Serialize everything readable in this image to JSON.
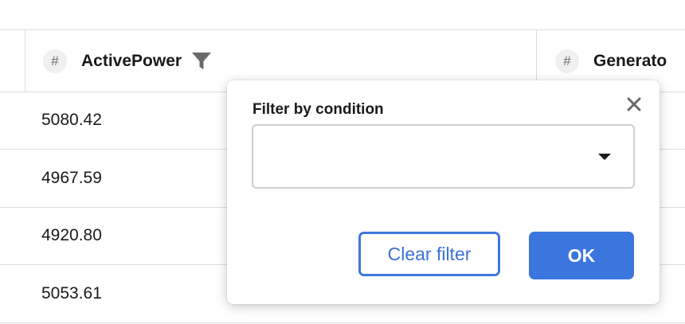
{
  "table": {
    "columns": [
      {
        "type_symbol": "#",
        "title": "ActivePower",
        "filter_icon": "filter-icon"
      },
      {
        "type_symbol": "#",
        "title": "Generato"
      }
    ],
    "rows": [
      {
        "active_power": "5080.42"
      },
      {
        "active_power": "4967.59"
      },
      {
        "active_power": "4920.80"
      },
      {
        "active_power": "5053.61"
      }
    ]
  },
  "filter_popup": {
    "label": "Filter by condition",
    "condition_value": "",
    "close_icon": "close-icon",
    "caret_icon": "caret-down-icon",
    "clear_label": "Clear filter",
    "ok_label": "OK"
  },
  "colors": {
    "accent": "#3b75de",
    "border": "#dcdcdc",
    "icon_gray": "#6b6b6b"
  }
}
